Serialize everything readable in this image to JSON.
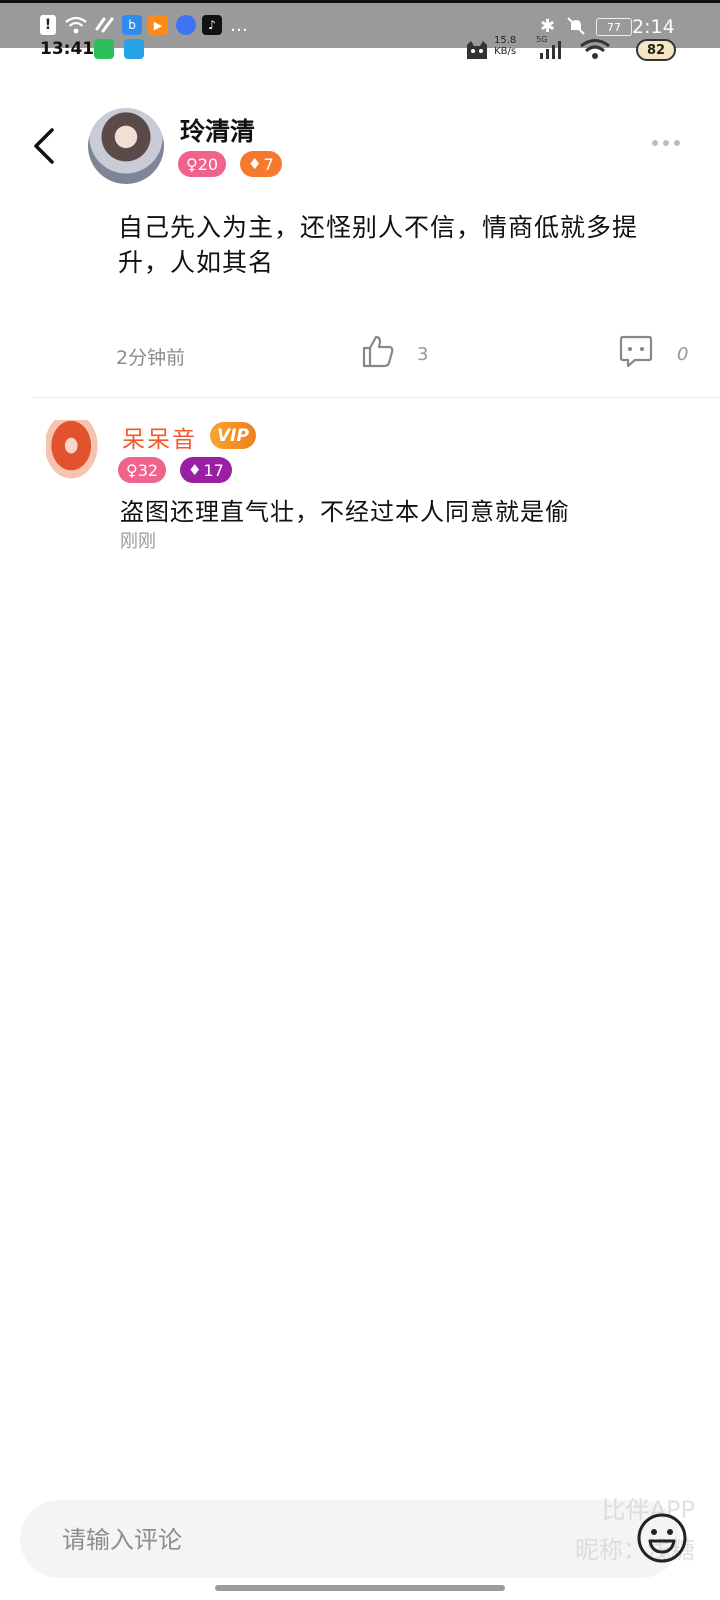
{
  "status_bar": {
    "time_left": "13:41",
    "time_right": "2:14",
    "net_speed_value": "15.8",
    "net_speed_unit": "KB/s",
    "network_type": "5G",
    "battery_top": "77",
    "battery_level": "82"
  },
  "post": {
    "author": "玲清清",
    "gender_badge": "♀20",
    "level_badge": "7",
    "content": "自己先入为主，还怪别人不信，情商低就多提升，人如其名",
    "time": "2分钟前",
    "like_count": "3",
    "comment_count": "0"
  },
  "replies": [
    {
      "author": "呆呆音",
      "vip_label": "VIP",
      "gender_badge": "♀32",
      "level_badge": "17",
      "content": "盗图还理直气壮，不经过本人同意就是偷",
      "time": "刚刚"
    }
  ],
  "comment_box": {
    "placeholder": "请输入评论"
  },
  "watermark": {
    "line1": "比伴APP",
    "line2": "昵称：浅糖"
  },
  "colors": {
    "gender_badge": "#f0638b",
    "level_badge_post": "#f57a2e",
    "level_badge_reply": "#9b1fa3",
    "vip": "#f39a2a",
    "reply_name": "#f25a2a"
  }
}
